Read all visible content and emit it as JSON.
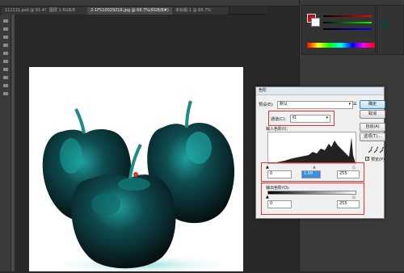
{
  "tabs": [
    {
      "label": "111111.psd @ 91.4%"
    },
    {
      "label": "图层 1 RGB/8"
    },
    {
      "label": "2-1F510029216.jpg @ 66.7%(RGB/8#)"
    },
    {
      "label": "未标题-1 @ 66.7%"
    }
  ],
  "dialog": {
    "title": "色阶",
    "preset_label": "预设(E):",
    "preset_value": "默认",
    "channel_label": "通道(C):",
    "channel_value": "红",
    "input_levels_label": "输入色阶(I):",
    "input_black": "0",
    "input_gamma": "1.00",
    "input_white": "255",
    "output_levels_label": "输出色阶(O):",
    "output_black": "0",
    "output_white": "255",
    "buttons": {
      "ok": "确定",
      "cancel": "取消",
      "auto": "自动(A)",
      "options": "选项(T)..."
    },
    "preview_label": "预览(P)"
  },
  "colors": {
    "accent_red": "#e8322b",
    "foreground": "#b5121b",
    "background": "#ffffff",
    "apple_teal": "#1f9f9c",
    "apple_dark": "#0a1416"
  }
}
